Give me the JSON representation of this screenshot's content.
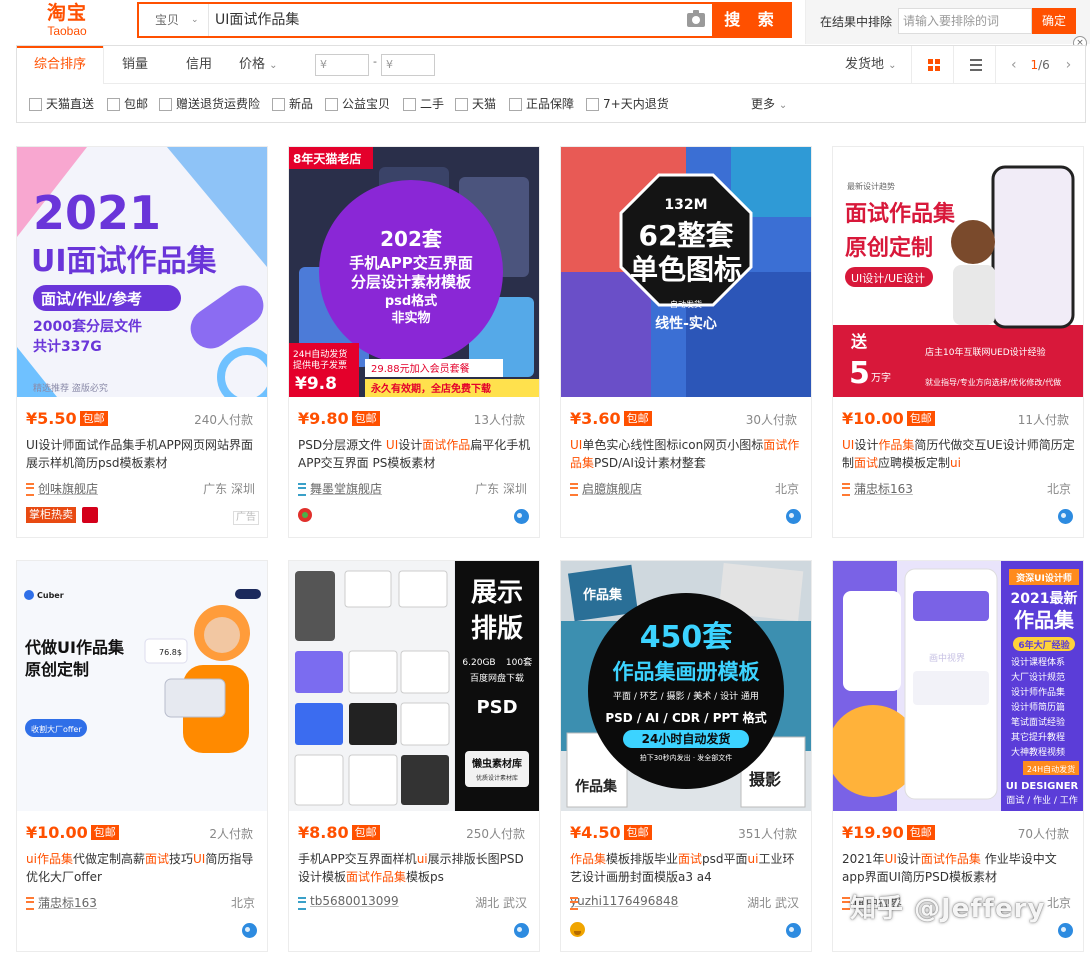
{
  "header": {
    "logo_cn": "淘宝",
    "logo_en": "Taobao",
    "search_type": "宝贝",
    "search_query": "UI面试作品集",
    "search_button": "搜 索",
    "exclude_label": "在结果中排除",
    "exclude_placeholder": "请输入要排除的词",
    "exclude_confirm": "确定",
    "close_glyph": "×"
  },
  "filter": {
    "sorts": [
      "综合排序",
      "销量",
      "信用",
      "价格"
    ],
    "price_min_placeholder": "¥",
    "price_max_placeholder": "¥",
    "price_dash": "-",
    "ship_from": "发货地",
    "pager_current": "1",
    "pager_total": "/6",
    "checkboxes": [
      "天猫直送",
      "包邮",
      "赠送退货运费险",
      "新品",
      "公益宝贝",
      "二手",
      "天猫",
      "正品保障",
      "7+天内退货"
    ],
    "more": "更多"
  },
  "colors": {
    "accent": "#ff5000"
  },
  "products": [
    {
      "image": {
        "lines": [
          "2021",
          "UI面试作品集",
          "面试/作业/参考",
          "2000套分层文件",
          "共计337G",
          "精选推荐 盗版必究"
        ]
      },
      "price": "¥5.50",
      "tag": "包邮",
      "sold": "240人付款",
      "title": [
        "UI设计师面试作品集手机APP网页网站界面展示样机简历psd模板素材"
      ],
      "shop": "创味旗舰店",
      "location": "广东 深圳",
      "hot": "掌柜热卖",
      "ad": "广告"
    },
    {
      "image": {
        "lines": [
          "8年天猫老店",
          "202套",
          "手机APP交互界面",
          "分层设计素材模板",
          "psd格式",
          "非实物",
          "24H自动发货",
          "提供电子发票",
          "¥9.8",
          "29.88元加入会员套餐",
          "永久有效期，全店免费下载"
        ]
      },
      "price": "¥9.80",
      "tag": "包邮",
      "sold": "13人付款",
      "title": [
        "PSD分层源文件 ",
        "UI",
        "设计",
        "面试作品",
        "扁平化手机APP交互界面 PS模板素材"
      ],
      "shop": "舞墨堂旗舰店",
      "location": "广东 深圳"
    },
    {
      "image": {
        "lines": [
          "132M",
          "62整套",
          "单色图标",
          "自动发货",
          "线性-实心"
        ]
      },
      "price": "¥3.60",
      "tag": "包邮",
      "sold": "30人付款",
      "title": [
        "UI",
        "单色实心线性图标icon网页小图标",
        "面试作品集",
        "PSD/AI设计素材整套"
      ],
      "shop": "启臆旗舰店",
      "location": "北京"
    },
    {
      "image": {
        "lines": [
          "最新设计趋势",
          "面试作品集",
          "原创定制",
          "UI设计/UE设计",
          "送",
          "5",
          "万字",
          "店主10年互联网UED设计经验",
          "就业指导/专业方向选择/优化修改/代做"
        ]
      },
      "price": "¥10.00",
      "tag": "包邮",
      "sold": "11人付款",
      "title": [
        "UI",
        "设计",
        "作品集",
        "简历代做交互UE设计师简历定制",
        "面试",
        "应聘模板定制",
        "ui"
      ],
      "shop": "蒲忠标163",
      "location": "北京"
    },
    {
      "image": {
        "lines": [
          "Cuber",
          "代做UI作品集",
          "原创定制",
          "收割大厂offer",
          "76.8$"
        ]
      },
      "price": "¥10.00",
      "tag": "包邮",
      "sold": "2人付款",
      "title": [
        "ui",
        "作品集",
        "代做定制高薪",
        "面试",
        "技巧",
        "UI",
        "简历指导优化大厂offer"
      ],
      "shop": "蒲忠标163",
      "location": "北京"
    },
    {
      "image": {
        "lines": [
          "展示",
          "排版",
          "6.20GB",
          "100套",
          "百度网盘下载",
          "PSD",
          "懒虫素材库",
          "优质设计素材库"
        ]
      },
      "price": "¥8.80",
      "tag": "包邮",
      "sold": "250人付款",
      "title": [
        "手机APP交互界面样机",
        "ui",
        "展示排版长图PSD设计模板",
        "面试作品集",
        "模板ps"
      ],
      "shop": "tb5680013099",
      "location": "湖北 武汉"
    },
    {
      "image": {
        "lines": [
          "作品集",
          "450套",
          "作品集画册模板",
          "平面 / 环艺 / 摄影 / 美术 / 设计 通用",
          "PSD / AI / CDR / PPT 格式",
          "24小时自动发货",
          "拍下30秒内发出 · 发全部文件",
          "作品集",
          "摄影"
        ]
      },
      "price": "¥4.50",
      "tag": "包邮",
      "sold": "351人付款",
      "title": [
        "作品集",
        "模板排版毕业",
        "面试",
        "psd平面",
        "ui",
        "工业环艺设计画册封面模版a3 a4"
      ],
      "shop": "yuzhi1176496848",
      "location": "湖北 武汉"
    },
    {
      "image": {
        "lines": [
          "资深UI设计师",
          "2021最新",
          "作品集",
          "6年大厂经验",
          "设计课程体系",
          "大厂设计规范",
          "设计师作品集",
          "设计师简历篇",
          "笔试面试经验",
          "其它提升教程",
          "大神教程视频",
          "24H自动发货",
          "UI DESIGNER",
          "面试 / 作业 / 工作",
          "画中视界"
        ]
      },
      "price": "¥19.90",
      "tag": "包邮",
      "sold": "70人付款",
      "title": [
        "2021年",
        "UI",
        "设计",
        "面试作品集",
        " 作业毕设中文app界面UI简历PSD模板素材"
      ],
      "shop": "画中视界",
      "location": "北京"
    }
  ],
  "watermark": "知乎 @Jeffery"
}
